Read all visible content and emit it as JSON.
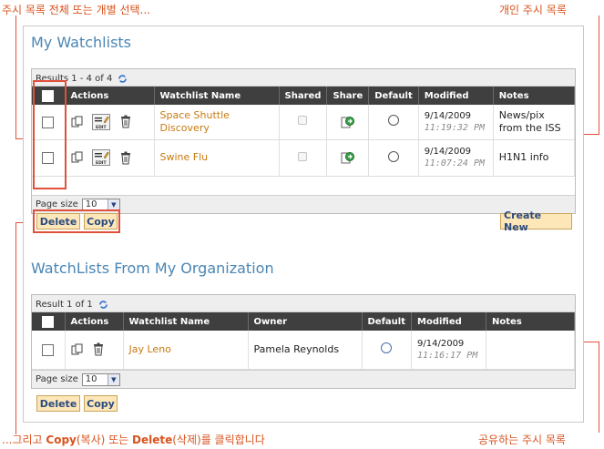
{
  "annotations": {
    "top_left": "주시 목록 전체 또는 개별 선택...",
    "top_right": "개인 주시 목록",
    "bottom_left_prefix": "...그리고 ",
    "bottom_left_copy": "Copy",
    "bottom_left_copy_kr": "(복사) 또는 ",
    "bottom_left_delete": "Delete",
    "bottom_left_suffix": "(삭제)를 클릭합니다",
    "bottom_right": "공유하는 주시 목록"
  },
  "my_watchlists": {
    "title": "My Watchlists",
    "results": "Results 1 - 4 of 4",
    "columns": {
      "actions": "Actions",
      "name": "Watchlist Name",
      "shared": "Shared",
      "share": "Share",
      "default": "Default",
      "modified": "Modified",
      "notes": "Notes"
    },
    "rows": [
      {
        "name": "Space Shuttle Discovery",
        "modified_date": "9/14/2009",
        "modified_time": "11:19:32 PM",
        "notes": "News/pix from the ISS"
      },
      {
        "name": "Swine Flu",
        "modified_date": "9/14/2009",
        "modified_time": "11:07:24 PM",
        "notes": "H1N1 info"
      }
    ],
    "page_size_label": "Page size",
    "page_size_value": "10",
    "delete_label": "Delete",
    "copy_label": "Copy",
    "create_new_label": "Create New",
    "edit_icon_text": "EDIT"
  },
  "org_watchlists": {
    "title": "WatchLists From My Organization",
    "results": "Result 1 of 1",
    "columns": {
      "actions": "Actions",
      "name": "Watchlist Name",
      "owner": "Owner",
      "default": "Default",
      "modified": "Modified",
      "notes": "Notes"
    },
    "rows": [
      {
        "name": "Jay Leno",
        "owner": "Pamela Reynolds",
        "modified_date": "9/14/2009",
        "modified_time": "11:16:17 PM",
        "notes": ""
      }
    ],
    "page_size_label": "Page size",
    "page_size_value": "10",
    "delete_label": "Delete",
    "copy_label": "Copy"
  },
  "colors": {
    "annotation": "#d9531e",
    "title": "#4a86b5",
    "link": "#c77a10",
    "header_bg": "#3f3f3f",
    "button_bg": "#fde7b8"
  }
}
